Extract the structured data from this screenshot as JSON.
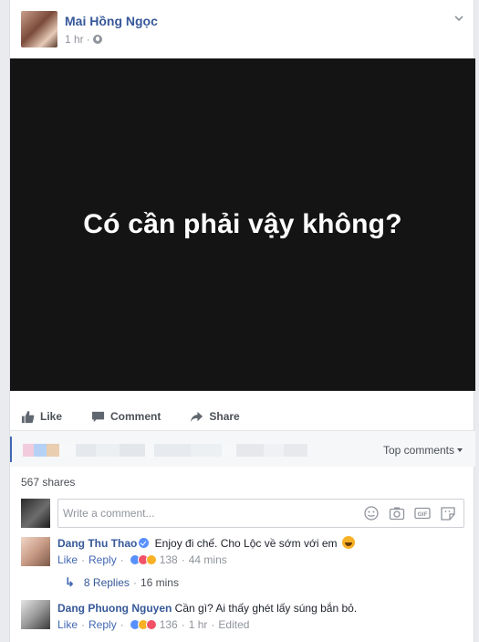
{
  "post": {
    "author": "Mai Hồng Ngọc",
    "time": "1 hr",
    "separator": "·",
    "photo_text": "Có cần phải vậy không?"
  },
  "actions": {
    "like": "Like",
    "comment": "Comment",
    "share": "Share"
  },
  "feedback": {
    "top_comments": "Top comments",
    "shares": "567 shares"
  },
  "composer": {
    "placeholder": "Write a comment..."
  },
  "comments": [
    {
      "name": "Dang Thu Thao",
      "verified": true,
      "text": "Enjoy đi chế. Cho Lộc về sớm với em",
      "like": "Like",
      "reply": "Reply",
      "reactions": "138",
      "time": "44 mins",
      "replies": "8 Replies",
      "replies_time": "16 mins"
    },
    {
      "name": "Dang Phuong Nguyen",
      "verified": false,
      "text": "Cần gì? Ai thấy ghét lấy súng bắn bỏ.",
      "like": "Like",
      "reply": "Reply",
      "reactions": "136",
      "time": "1 hr",
      "edited": "Edited"
    }
  ],
  "colors": {
    "link": "#365899",
    "accent": "#4267b2",
    "muted": "#90949c",
    "photo_bg": "#141414"
  },
  "icons": [
    "globe-icon",
    "chevron-down-icon",
    "like-icon",
    "comment-icon",
    "share-icon",
    "emoji-icon",
    "camera-icon",
    "gif-icon",
    "sticker-icon",
    "verified-icon",
    "reply-arrow-icon"
  ]
}
